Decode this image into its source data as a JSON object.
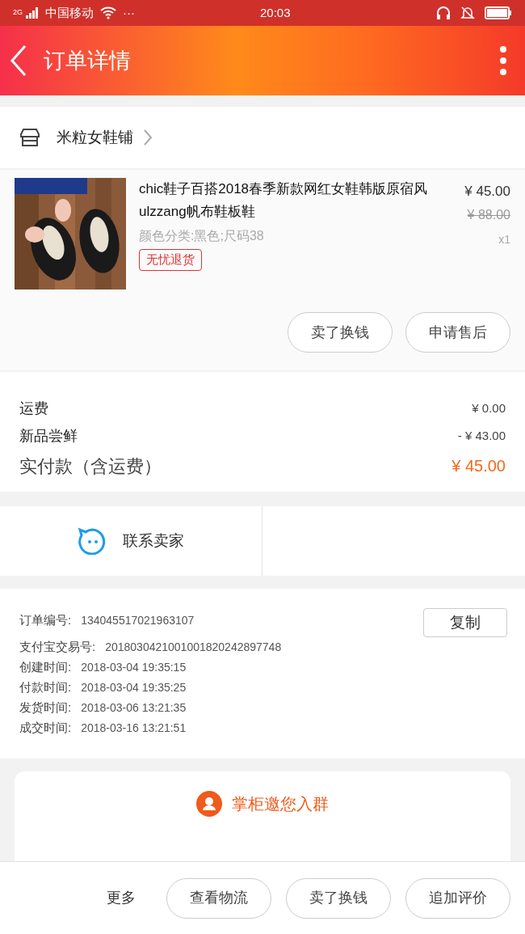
{
  "status_bar": {
    "network": "2G",
    "carrier": "中国移动",
    "more": "···",
    "time": "20:03"
  },
  "header": {
    "title": "订单详情"
  },
  "shop": {
    "name": "米粒女鞋铺"
  },
  "product": {
    "title": "chic鞋子百搭2018春季新款网红女鞋韩版原宿风ulzzang帆布鞋板鞋",
    "variant": "颜色分类:黑色;尺码38",
    "badge": "无忧退货",
    "price": "¥ 45.00",
    "original_price": "¥ 88.00",
    "quantity": "x1",
    "actions": [
      "卖了换钱",
      "申请售后"
    ]
  },
  "costs": [
    {
      "label": "运费",
      "value": "¥ 0.00",
      "kind": "line"
    },
    {
      "label": "新品尝鲜",
      "value": "- ¥ 43.00",
      "kind": "line"
    },
    {
      "label": "实付款（含运费）",
      "value": "¥ 45.00",
      "kind": "total"
    }
  ],
  "contact": {
    "label": "联系卖家"
  },
  "order_info": {
    "copy_button": "复制",
    "rows": [
      {
        "label": "订单编号:",
        "value": "134045517021963107"
      },
      {
        "label": "支付宝交易号:",
        "value": "2018030421001001820242897748"
      },
      {
        "label": "创建时间:",
        "value": "2018-03-04 19:35:15"
      },
      {
        "label": "付款时间:",
        "value": "2018-03-04 19:35:25"
      },
      {
        "label": "发货时间:",
        "value": "2018-03-06 13:21:35"
      },
      {
        "label": "成交时间:",
        "value": "2018-03-16 13:21:51"
      }
    ]
  },
  "group_card": {
    "title": "掌柜邀您入群"
  },
  "bottom_bar": {
    "more": "更多",
    "buttons": [
      "查看物流",
      "卖了换钱",
      "追加评价"
    ]
  }
}
